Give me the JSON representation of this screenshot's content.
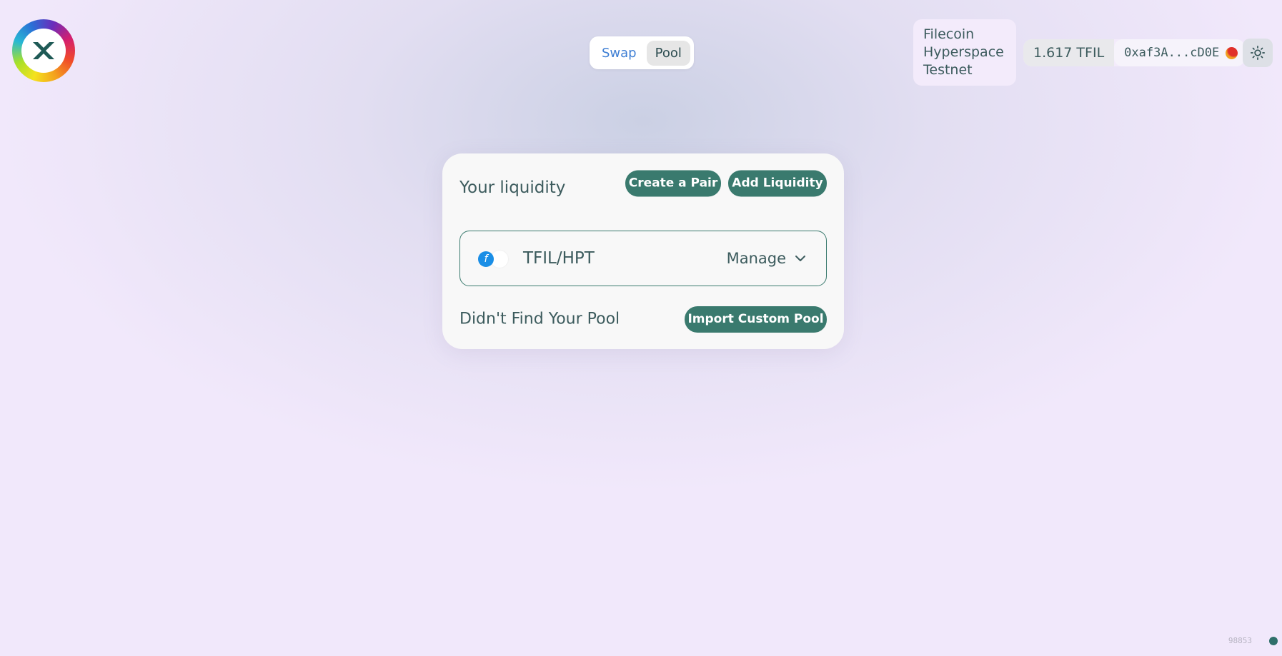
{
  "header": {
    "logo_icon": "x-logo-icon",
    "nav": {
      "tabs": [
        {
          "label": "Swap",
          "active": false
        },
        {
          "label": "Pool",
          "active": true
        }
      ]
    },
    "network": {
      "lines": [
        "Filecoin",
        "Hyperspace",
        "Testnet"
      ]
    },
    "wallet": {
      "balance": "1.617 TFIL",
      "address": "0xaf3A...cD0E",
      "avatar_icon": "account-avatar-icon"
    },
    "theme_toggle_icon": "sun-icon"
  },
  "liquidity": {
    "title": "Your liquidity",
    "create_pair_label": "Create a Pair",
    "add_liquidity_label": "Add Liquidity",
    "pairs": [
      {
        "name": "TFIL/HPT",
        "token0_icon": "filecoin-icon",
        "token0_glyph": "f",
        "token1_icon": "token-placeholder-icon",
        "manage_label": "Manage"
      }
    ],
    "not_found_text": "Didn't Find Your Pool",
    "import_label": "Import Custom Pool"
  },
  "footer": {
    "block_number": "98853"
  },
  "colors": {
    "accent": "#3a7a6e",
    "text": "#3c5b5d",
    "link": "#3f7fd4",
    "background": "#f1e8fb"
  }
}
